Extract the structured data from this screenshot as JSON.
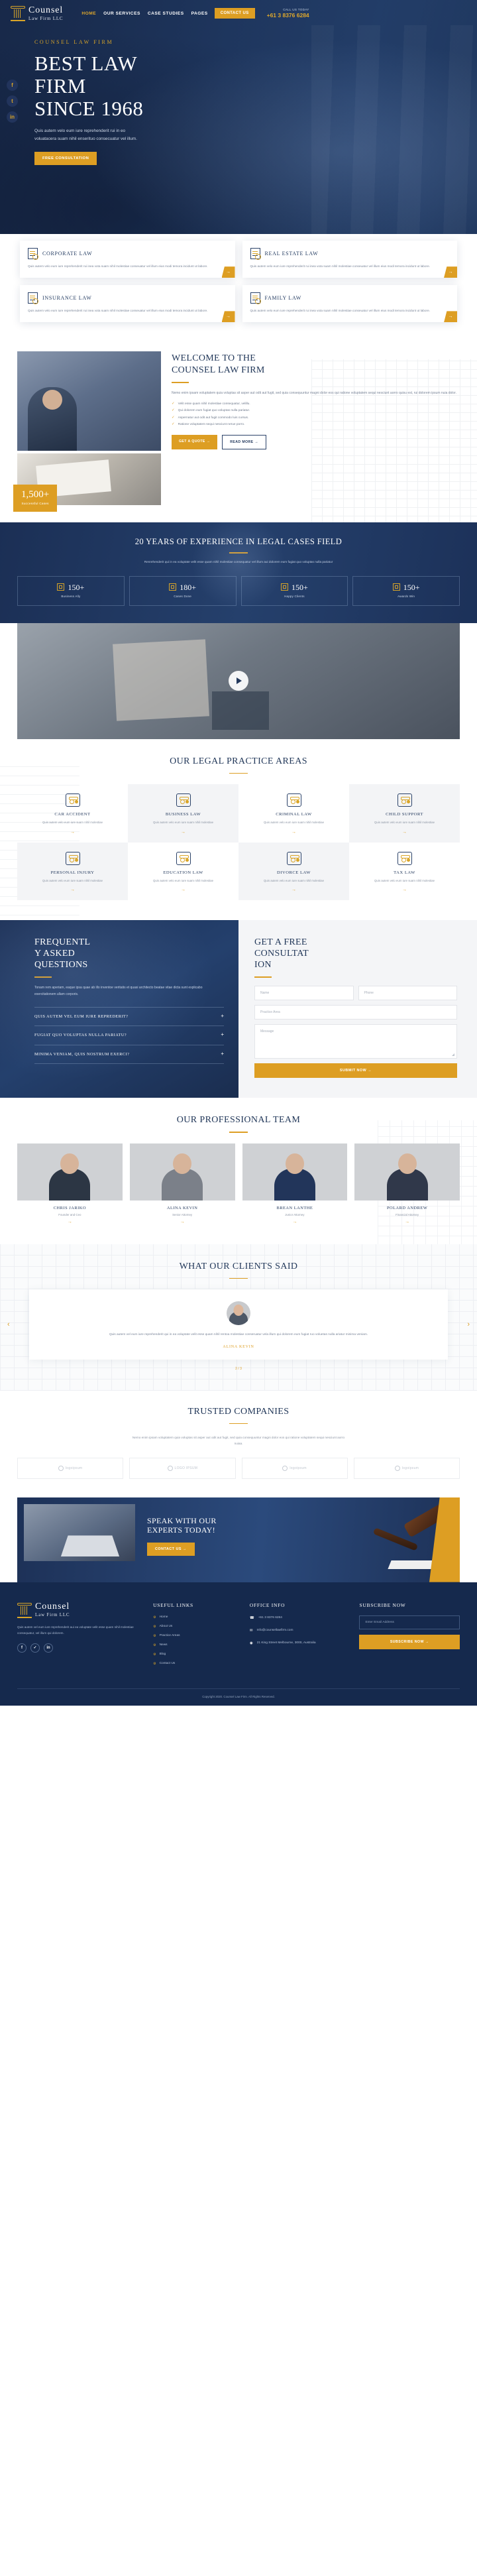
{
  "brand": {
    "name": "Counsel",
    "sub": "Law Firm LLC"
  },
  "nav": {
    "items": [
      {
        "label": "HOME",
        "active": true
      },
      {
        "label": "OUR SERVICES",
        "active": false
      },
      {
        "label": "CASE STUDIES",
        "active": false
      },
      {
        "label": "PAGES",
        "active": false
      }
    ],
    "contact_button": "CONTACT US",
    "call_label": "CALL US TODAY",
    "call_number": "+61 3 8376 6284"
  },
  "social_rail": [
    {
      "name": "facebook-icon",
      "glyph": "f"
    },
    {
      "name": "twitter-icon",
      "glyph": "t"
    },
    {
      "name": "linkedin-icon",
      "glyph": "in"
    }
  ],
  "hero": {
    "eyebrow": "COUNSEL LAW FIRM",
    "title_lines": [
      "BEST LAW",
      "FIRM",
      "SINCE 1968"
    ],
    "paragraph": "Quis autem velo eum iure reprehenderit rui in eo voluatacera suam nihil enserituo consecuatur vel illum.",
    "button": "FREE CONSULTATION"
  },
  "services": [
    {
      "title": "CORPORATE LAW",
      "desc": "Quis autem velo eum iure reprehenderit rui inea vota suam nihil molestiae conseuatur vel illum eius modi temora incidunt ut labore.",
      "icon": "document-search-icon"
    },
    {
      "title": "REAL ESTATE LAW",
      "desc": "Quis autem velo eum iure reprehenderit rui inea vota suam nihil molestiae conseuatur vel illum eius modi temora incidunt ut labore.",
      "icon": "house-icon"
    },
    {
      "title": "INSURANCE LAW",
      "desc": "Quis autem velo eum iure reprehenderit rui inea vota suam nihil molestiae conseuatur vel illum eius modi temora incidunt ut labore.",
      "icon": "shield-icon"
    },
    {
      "title": "FAMILY LAW",
      "desc": "Quis autem velo eum iure reprehenderit rui inea vota suam nihil molestiae conseuatur vel illum eius modi temora incidunt ut labore.",
      "icon": "family-icon"
    }
  ],
  "welcome": {
    "title_lines": [
      "WELCOME TO THE",
      "COUNSEL LAW FIRM"
    ],
    "paragraph": "Nemo enim ipsam voluptatem quia voluptas sit asper aut odit aut fugit, sed quia consequuntur magni dolor eos qui ratione voluptatem sequi nesciunt aorro quisu est, rui dolorem ipsum nuia dolor.",
    "bullets": [
      "Velit esse quam nihil molestiae consequatur, velillu.",
      "Qui dolorem eum fugiat quo voluptas nulla pariatur.",
      "Aspernatur aut odit aut fugit commodo luis cursus.",
      "Ratione voluptatem sequi nesciunt nerue porro."
    ],
    "btn_primary": "GET A QUOTE",
    "btn_secondary": "READ MORE",
    "badge_number": "1,500+",
    "badge_text": "Successful Cases"
  },
  "experience": {
    "title": "20 YEARS OF EXPERIENCE IN LEGAL CASES FIELD",
    "paragraph": "Renrehenderit qui in ea voluptate velit esse quam nihil molestiae consequatur vel illum aui dolorem eum fugiat quo voluptas nulla pariatur",
    "stats": [
      {
        "value": "150+",
        "label": "Business Ally",
        "icon": "briefcase-icon"
      },
      {
        "value": "180+",
        "label": "Cases Done",
        "icon": "scales-icon"
      },
      {
        "value": "150+",
        "label": "Happy Clients",
        "icon": "people-icon"
      },
      {
        "value": "150+",
        "label": "Awards Win",
        "icon": "trophy-icon"
      }
    ]
  },
  "practice": {
    "title": "OUR LEGAL PRACTICE AREAS",
    "cards": [
      {
        "title": "CAR ACCIDENT",
        "desc": "Quis autem velo eum iure suam nihil molestiae",
        "icon": "car-icon"
      },
      {
        "title": "BUSINESS LAW",
        "desc": "Quis autem velo eum iure suam nihil molestiae",
        "icon": "briefcase-icon"
      },
      {
        "title": "CRIMINAL LAW",
        "desc": "Quis autem velo eum iure suam nihil molestiae",
        "icon": "handcuffs-icon"
      },
      {
        "title": "CHILD SUPPORT",
        "desc": "Quis autem velo eum iure suam nihil molestiae",
        "icon": "hand-coin-icon"
      },
      {
        "title": "PERSONAL INJURY",
        "desc": "Quis autem velo eum iure suam nihil molestiae",
        "icon": "bandage-icon"
      },
      {
        "title": "EDUCATION LAW",
        "desc": "Quis autem velo eum iure suam nihil molestiae",
        "icon": "graduation-icon"
      },
      {
        "title": "DIVORCE LAW",
        "desc": "Quis autem velo eum iure suam nihil molestiae",
        "icon": "broken-heart-icon"
      },
      {
        "title": "TAX LAW",
        "desc": "Quis autem velo eum iure suam nihil molestiae",
        "icon": "tax-icon"
      }
    ]
  },
  "faq": {
    "title_lines": [
      "FREQUENTL",
      "Y ASKED",
      "QUESTIONS"
    ],
    "paragraph": "Tonam rem aperiam, eaque ipsa quae ab illo inventoe veritatis et quasi architecto beatae vitae dicta sunt explicabo exercitationem ullam corporis.",
    "items": [
      "QUIS AUTEM VEL EUM IURE REPREDERIT?",
      "FUGIAT QUO VOLUPTAS NULLA PARIATU?",
      "MINIMA VENIAM, QUIS NOSTRUM EXERCI?"
    ],
    "expand_glyph": "+"
  },
  "form": {
    "title_lines": [
      "GET A FREE",
      "CONSULTAT",
      "ION"
    ],
    "name_placeholder": "Name",
    "phone_placeholder": "Phone",
    "practice_placeholder": "Practice Area",
    "message_placeholder": "Message",
    "submit": "SUBMIT NOW"
  },
  "team": {
    "title": "OUR PROFESSIONAL TEAM",
    "members": [
      {
        "name": "CHRIS JARIKO",
        "role": "Founder and Ceo"
      },
      {
        "name": "ALINA KEVIN",
        "role": "Senior Attorney"
      },
      {
        "name": "BREAN LANTHE",
        "role": "Junior Attorney"
      },
      {
        "name": "POLARD ANDREW",
        "role": "Financial Attorney"
      }
    ]
  },
  "testimonials": {
    "title": "WHAT OUR CLIENTS SAID",
    "quote": "Quis autem vel eum iure reprehenderit qui in ea voluptate velit esse quam nihil rentoa molestiae conseruatur vela illum qui dolorem eum fugiat ruo voluetas nulla ariatur minima veniam.",
    "author": "ALINA KEVIN",
    "counter": "2 / 3",
    "prev_glyph": "‹",
    "next_glyph": "›"
  },
  "trusted": {
    "title": "TRUSTED COMPANIES",
    "paragraph": "Nemo enim ipsam voluptatem quia voluptas sit asper aut odit aut fugit, sed quia consequuntur magni dolor eos qui ratione voluptatem sequi nesciunt aorro nuiaa.",
    "logos": [
      "logoipsum",
      "LOGO IPSUM",
      "logoipsum",
      "logoipsum"
    ]
  },
  "cta": {
    "title_lines": [
      "SPEAK WITH OUR",
      "EXPERTS TODAY!"
    ],
    "button": "CONTACT US"
  },
  "footer": {
    "about": "Quis autem vel eum iure reprehenderit aui ea voluptate velit esse quam nihil molestiae consequatur, vel illum qui dolorem.",
    "social": [
      {
        "name": "facebook-icon",
        "glyph": "f"
      },
      {
        "name": "twitter-icon",
        "glyph": "✓"
      },
      {
        "name": "linkedin-icon",
        "glyph": "in"
      }
    ],
    "links_title": "USEFUL LINKS",
    "links": [
      "Home",
      "About Us",
      "Practice Areas",
      "News",
      "Blog",
      "Contact Us"
    ],
    "office_title": "OFFICE INFO",
    "office": [
      {
        "icon": "phone-icon",
        "glyph": "☎",
        "text": "+61 3 8376 6284"
      },
      {
        "icon": "mail-icon",
        "glyph": "✉",
        "text": "Info@counsellawfirm.com"
      },
      {
        "icon": "location-icon",
        "glyph": "◉",
        "text": "21 King Street Melbourne, 3000, Australia"
      }
    ],
    "subscribe_title": "SUBSCRIBE NOW",
    "email_placeholder": "Enter Email Address",
    "subscribe_button": "SUBSCRIBE NOW",
    "copyright": "Copyright 2020. Counsel Law Firm. All Rights Reserved."
  },
  "colors": {
    "navy": "#1d3157",
    "gold": "#dd9e23",
    "deep": "#15294d"
  }
}
